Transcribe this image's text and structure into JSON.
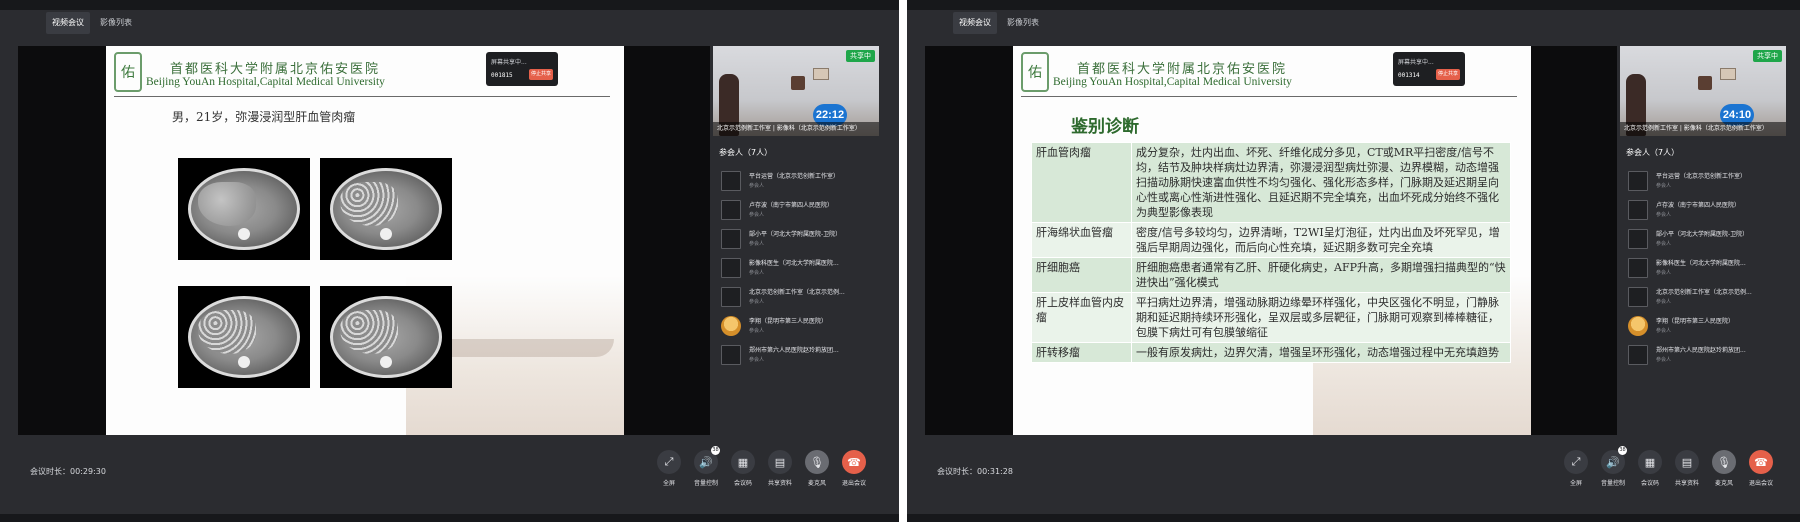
{
  "tabs": [
    "视频会议",
    "影像列表"
  ],
  "hospital": {
    "logo_text": "佑",
    "name_cn": "首都医科大学附属北京佑安医院",
    "name_en": "Beijing YouAn Hospital,Capital Medical University"
  },
  "colors": {
    "accent_green": "#1fa64a",
    "timer_blue": "#1b74d1",
    "end_red": "#e5604a"
  },
  "windows": [
    {
      "popup": {
        "line1": "屏幕共享中...",
        "time": "001815",
        "stop": "停止共享"
      },
      "slide": {
        "title": "男，21岁，弥漫浸润型肝血管肉瘤",
        "footer": ""
      },
      "remote_timer": "22:12",
      "duration_label": "会议时长：00:29:30"
    },
    {
      "popup": {
        "line1": "屏幕共享中...",
        "time": "001314",
        "stop": "停止共享"
      },
      "slide": {
        "title": "鉴别诊断",
        "rows": [
          {
            "name": "肝血管肉瘤",
            "desc": "成分复杂，灶内出血、坏死、纤维化成分多见，CT或MR平扫密度/信号不均，结节及肿块样病灶边界清，弥漫浸润型病灶弥漫、边界模糊，动态增强扫描动脉期快速富血供性不均匀强化、强化形态多样，门脉期及延迟期呈向心性或离心性渐进性强化、且延迟期不完全填充，出血坏死成分始终不强化为典型影像表现"
          },
          {
            "name": "肝海绵状血管瘤",
            "desc": "密度/信号多较均匀，边界清晰，T2WI呈灯泡征，灶内出血及坏死罕见，增强后早期周边强化，而后向心性充填，延迟期多数可完全充填"
          },
          {
            "name": "肝细胞癌",
            "desc": "肝细胞癌患者通常有乙肝、肝硬化病史，AFP升高，多期增强扫描典型的“快进快出”强化模式"
          },
          {
            "name": "肝上皮样血管内皮瘤",
            "desc": "平扫病灶边界清，增强动脉期边缘晕环样强化，中央区强化不明显，门静脉期和延迟期持续环形强化，呈双层或多层靶征，门脉期可观察到棒棒糖征，包膜下病灶可有包膜皱缩征"
          },
          {
            "name": "肝转移瘤",
            "desc": "一般有原发病灶，边界欠清，增强呈环形强化，动态增强过程中无充填趋势"
          }
        ]
      },
      "remote_timer": "24:10",
      "duration_label": "会议时长：00:31:28"
    }
  ],
  "side": {
    "share_badge": "共享中",
    "caption": "北京示范例新工作室 | 影像科（北京示范例新工作室）",
    "participants_title": "参会人（7人）",
    "participants": [
      {
        "name": "平台运营（北京示范创新工作室）",
        "role": "参会人",
        "avatar": "placeholder"
      },
      {
        "name": "卢存波（南宁市第四人民医院）",
        "role": "参会人",
        "avatar": "placeholder"
      },
      {
        "name": "郜小平（河北大学附属医院-卫院）",
        "role": "参会人",
        "avatar": "placeholder"
      },
      {
        "name": "影像科医生（河北大学附属医院...",
        "role": "参会人",
        "avatar": "placeholder"
      },
      {
        "name": "北京示范创新工作室（北京示范例...",
        "role": "参会人",
        "avatar": "placeholder"
      },
      {
        "name": "李翔（昆明市第三人民医院）",
        "role": "参会人",
        "avatar": "photo"
      },
      {
        "name": "郑州市第六人民医院赵玲莉放团...",
        "role": "参会人",
        "avatar": "placeholder"
      }
    ]
  },
  "controls": [
    {
      "label": "全屏",
      "icon": "fullscreen-icon",
      "glyph": "⤢"
    },
    {
      "label": "音量控制",
      "icon": "volume-icon",
      "glyph": "🔊",
      "badge": "38"
    },
    {
      "label": "会议码",
      "icon": "qr-code-icon",
      "glyph": "▦"
    },
    {
      "label": "共享资料",
      "icon": "document-icon",
      "glyph": "▤"
    },
    {
      "label": "麦克风",
      "icon": "microphone-icon",
      "glyph": "🎙"
    },
    {
      "label": "退出会议",
      "icon": "hangup-icon",
      "glyph": "☎"
    }
  ]
}
